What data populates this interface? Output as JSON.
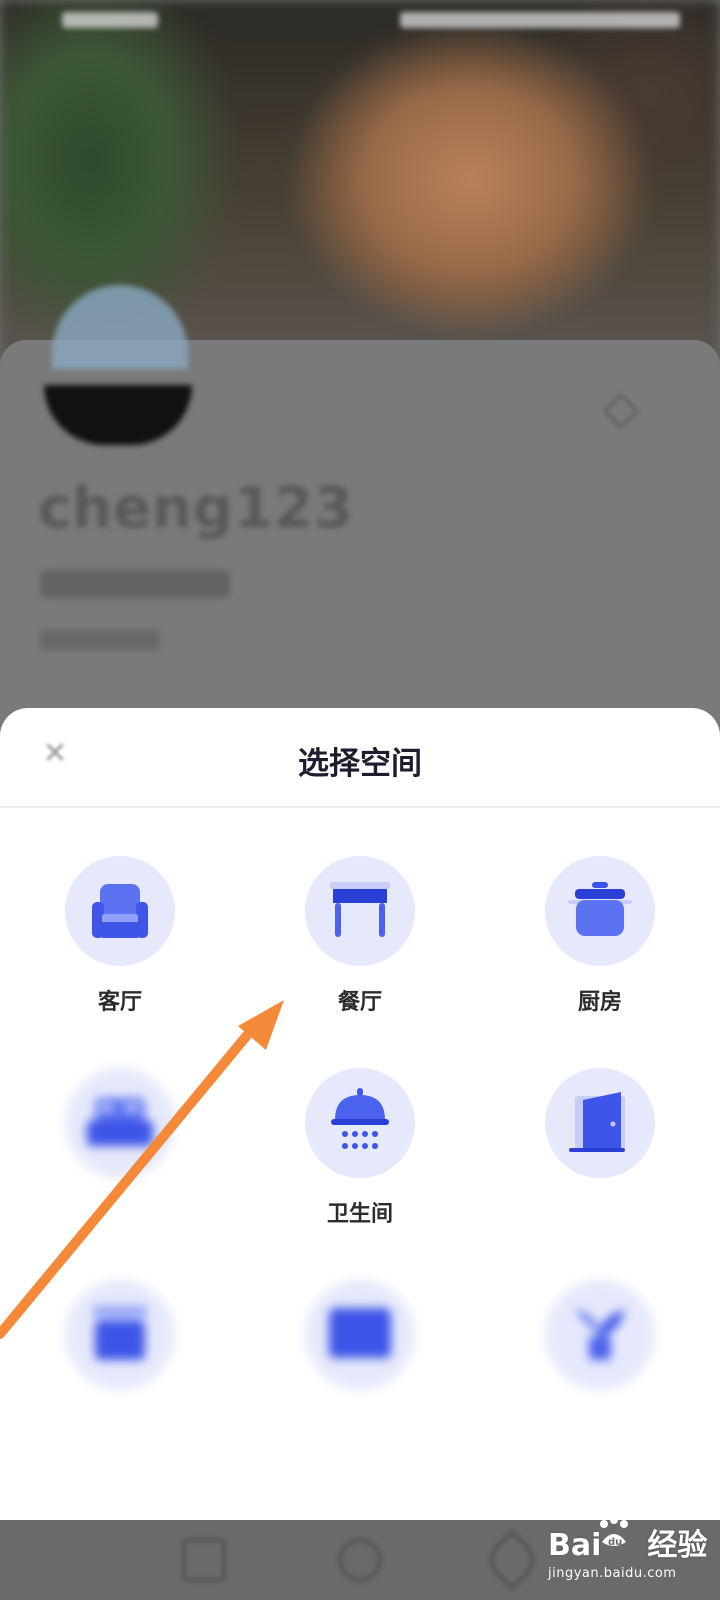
{
  "background": {
    "profile": {
      "username": "cheng123"
    }
  },
  "sheet": {
    "title": "选择空间",
    "close_icon": "close-icon",
    "spaces": [
      {
        "label": "客厅",
        "icon": "sofa-icon"
      },
      {
        "label": "餐厅",
        "icon": "dining-table-icon"
      },
      {
        "label": "厨房",
        "icon": "cooking-pot-icon"
      },
      {
        "label": "",
        "icon": "bed-icon"
      },
      {
        "label": "卫生间",
        "icon": "shower-icon"
      },
      {
        "label": "",
        "icon": "door-icon"
      },
      {
        "label": "",
        "icon": "cabinet-icon"
      },
      {
        "label": "",
        "icon": "screen-icon"
      },
      {
        "label": "",
        "icon": "plant-icon"
      }
    ]
  },
  "colors": {
    "icon_primary": "#3d55e8",
    "icon_circle": "#e6e9fb",
    "arrow": "#f5893a",
    "overlay": "#6b6b6b"
  },
  "watermark": {
    "logo_left": "Bai",
    "logo_right": "经验",
    "url": "jingyan.baidu.com"
  }
}
